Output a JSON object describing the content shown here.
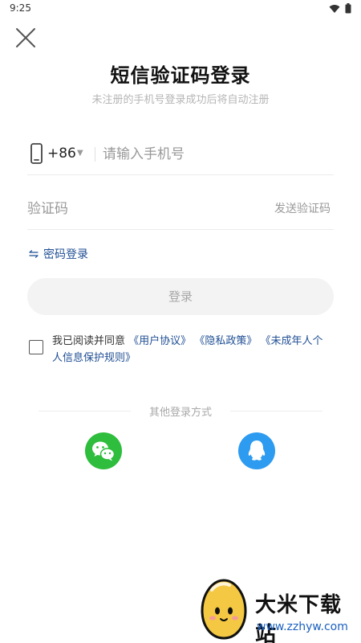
{
  "status_bar": {
    "time": "9:25",
    "icons": [
      "wifi-icon",
      "battery-icon"
    ]
  },
  "header": {
    "close_icon": "close-icon",
    "title": "短信验证码登录",
    "subtitle": "未注册的手机号登录成功后将自动注册"
  },
  "phone": {
    "icon": "phone-icon",
    "country_code": "+86",
    "arrow": "▼",
    "placeholder": "请输入手机号"
  },
  "code": {
    "placeholder": "验证码",
    "send_label": "发送验证码"
  },
  "password_login": {
    "icon": "swap-icon",
    "label": "密码登录"
  },
  "login_button": {
    "label": "登录"
  },
  "agreement": {
    "prefix": "我已阅读并同意",
    "links": [
      "《用户协议》",
      "《隐私政策》",
      "《未成年人个人信息保护规则》"
    ]
  },
  "other_login": {
    "label": "其他登录方式",
    "options": [
      {
        "name": "wechat",
        "icon": "wechat-icon",
        "color": "#2ebd3c"
      },
      {
        "name": "qq",
        "icon": "qq-icon",
        "color": "#2d9bf0"
      }
    ]
  },
  "watermark": {
    "title": "大米下载站",
    "url": "www.zzhyw.com"
  },
  "colors": {
    "link": "#1f4e94",
    "button_bg": "#f3f3f3",
    "button_text": "#a8a8a8"
  }
}
